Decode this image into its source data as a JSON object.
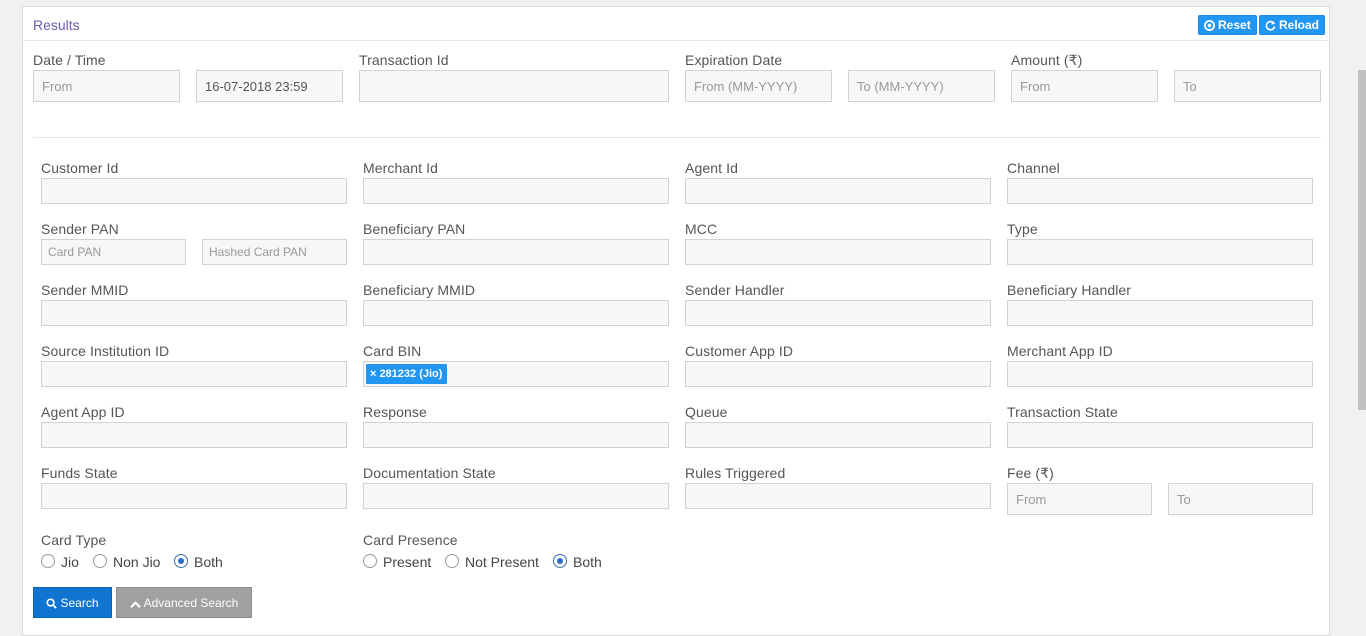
{
  "header": {
    "title": "Results",
    "reset_label": "Reset",
    "reload_label": "Reload"
  },
  "top_filters": {
    "date_time": {
      "label": "Date / Time",
      "from_placeholder": "From",
      "to_value": "16-07-2018 23:59"
    },
    "transaction_id": {
      "label": "Transaction Id",
      "value": ""
    },
    "expiration_date": {
      "label": "Expiration Date",
      "from_placeholder": "From (MM-YYYY)",
      "to_placeholder": "To (MM-YYYY)"
    },
    "amount": {
      "label": "Amount (₹)",
      "from_placeholder": "From",
      "to_placeholder": "To"
    }
  },
  "fields": {
    "customer_id": "Customer Id",
    "merchant_id": "Merchant Id",
    "agent_id": "Agent Id",
    "channel": "Channel",
    "sender_pan": {
      "label": "Sender PAN",
      "card_pan_placeholder": "Card PAN",
      "hashed_pan_placeholder": "Hashed Card PAN"
    },
    "beneficiary_pan": "Beneficiary PAN",
    "mcc": "MCC",
    "type": "Type",
    "sender_mmid": "Sender MMID",
    "beneficiary_mmid": "Beneficiary MMID",
    "sender_handler": "Sender Handler",
    "beneficiary_handler": "Beneficiary Handler",
    "source_institution_id": "Source Institution ID",
    "card_bin": {
      "label": "Card BIN",
      "chips": [
        "281232 (Jio)"
      ]
    },
    "customer_app_id": "Customer App ID",
    "merchant_app_id": "Merchant App ID",
    "agent_app_id": "Agent App ID",
    "response": "Response",
    "queue": "Queue",
    "transaction_state": "Transaction State",
    "funds_state": "Funds State",
    "documentation_state": "Documentation State",
    "rules_triggered": "Rules Triggered",
    "fee": {
      "label": "Fee (₹)",
      "from_placeholder": "From",
      "to_placeholder": "To"
    }
  },
  "card_type": {
    "label": "Card Type",
    "options": [
      "Jio",
      "Non Jio",
      "Both"
    ],
    "selected": "Both"
  },
  "card_presence": {
    "label": "Card Presence",
    "options": [
      "Present",
      "Not Present",
      "Both"
    ],
    "selected": "Both"
  },
  "actions": {
    "search_label": "Search",
    "advanced_search_label": "Advanced Search"
  },
  "colors": {
    "accent": "#2196f3",
    "title": "#6f5aa8",
    "search_button": "#0f75d1",
    "advanced_button": "#a0a0a0"
  }
}
